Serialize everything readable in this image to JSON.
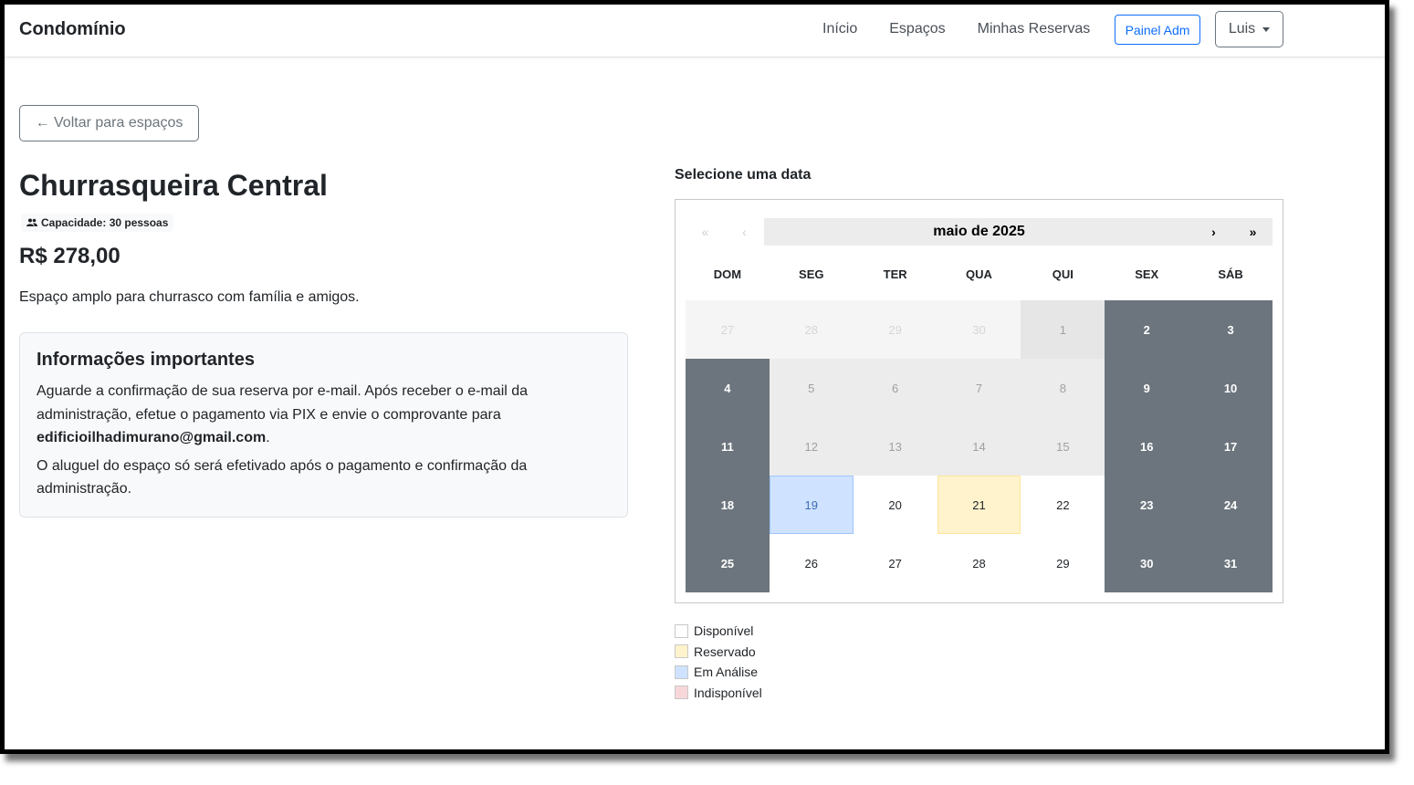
{
  "navbar": {
    "brand": "Condomínio",
    "links": [
      "Início",
      "Espaços",
      "Minhas Reservas"
    ],
    "admin_button": "Painel Adm",
    "user_button": "Luis"
  },
  "page": {
    "back_button": "← Voltar para espaços",
    "title": "Churrasqueira Central",
    "capacity": "Capacidade: 30 pessoas",
    "price": "R$ 278,00",
    "description": "Espaço amplo para churrasco com família e amigos."
  },
  "info": {
    "title": "Informações importantes",
    "p1_before": "Aguarde a confirmação de sua reserva por e-mail. Após receber o e-mail da administração, efetue o pagamento via PIX e envie o comprovante para ",
    "p1_email": "edificioilhadimurano@gmail.com",
    "p1_after": ".",
    "p2": "O aluguel do espaço só será efetivado após o pagamento e confirmação da administração."
  },
  "calendar": {
    "heading": "Selecione uma data",
    "month_label": "maio de 2025",
    "nav": {
      "prev2": "«",
      "prev": "‹",
      "next": "›",
      "next2": "»"
    },
    "weekdays": [
      "DOM",
      "SEG",
      "TER",
      "QUA",
      "QUI",
      "SEX",
      "SÁB"
    ],
    "days": [
      {
        "n": "27",
        "s": "neighbor"
      },
      {
        "n": "28",
        "s": "neighbor"
      },
      {
        "n": "29",
        "s": "neighbor"
      },
      {
        "n": "30",
        "s": "neighbor"
      },
      {
        "n": "1",
        "s": "past-dark"
      },
      {
        "n": "2",
        "s": "weekend"
      },
      {
        "n": "3",
        "s": "weekend"
      },
      {
        "n": "4",
        "s": "weekend"
      },
      {
        "n": "5",
        "s": "past"
      },
      {
        "n": "6",
        "s": "past"
      },
      {
        "n": "7",
        "s": "past"
      },
      {
        "n": "8",
        "s": "past"
      },
      {
        "n": "9",
        "s": "weekend"
      },
      {
        "n": "10",
        "s": "weekend"
      },
      {
        "n": "11",
        "s": "weekend"
      },
      {
        "n": "12",
        "s": "past"
      },
      {
        "n": "13",
        "s": "past"
      },
      {
        "n": "14",
        "s": "past"
      },
      {
        "n": "15",
        "s": "past"
      },
      {
        "n": "16",
        "s": "weekend"
      },
      {
        "n": "17",
        "s": "weekend"
      },
      {
        "n": "18",
        "s": "weekend"
      },
      {
        "n": "19",
        "s": "analysis"
      },
      {
        "n": "20",
        "s": "free"
      },
      {
        "n": "21",
        "s": "reserved"
      },
      {
        "n": "22",
        "s": "free"
      },
      {
        "n": "23",
        "s": "weekend"
      },
      {
        "n": "24",
        "s": "weekend"
      },
      {
        "n": "25",
        "s": "weekend"
      },
      {
        "n": "26",
        "s": "free"
      },
      {
        "n": "27",
        "s": "free"
      },
      {
        "n": "28",
        "s": "free"
      },
      {
        "n": "29",
        "s": "free"
      },
      {
        "n": "30",
        "s": "weekend"
      },
      {
        "n": "31",
        "s": "weekend"
      }
    ]
  },
  "legend": [
    {
      "label": "Disponível",
      "color": "#ffffff"
    },
    {
      "label": "Reservado",
      "color": "#fff3cd"
    },
    {
      "label": "Em Análise",
      "color": "#cfe2ff"
    },
    {
      "label": "Indisponível",
      "color": "#f8d7da"
    }
  ]
}
